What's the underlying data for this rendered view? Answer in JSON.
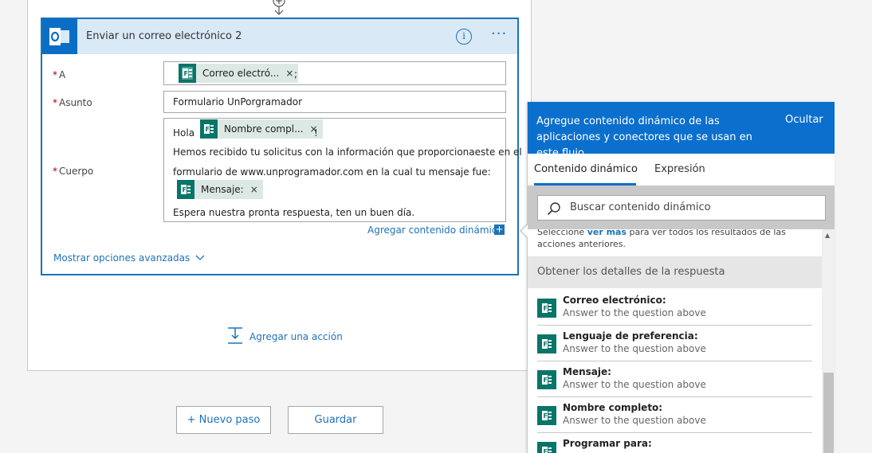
{
  "action": {
    "title": "Enviar un correo electrónico 2",
    "info_glyph": "i",
    "more_glyph": "···",
    "to_label": "A",
    "to_token": "Correo electró...",
    "to_separator": ";",
    "subject_label": "Asunto",
    "subject_value": "Formulario UnPorgramador",
    "body_label": "Cuerpo",
    "body_greeting": "Hola",
    "body_name_token": "Nombre compl...",
    "body_exclaim": "!",
    "body_line1": "Hemos recibido tu solicitus con la información que proporcionaeste en el",
    "body_line2": "formulario de www.unprogramador.com en la cual tu mensaje fue:",
    "body_message_token": "Mensaje:",
    "body_line3": "Espera nuestra pronta respuesta, ten un buen día.",
    "required_mark": "*",
    "token_remove": "×",
    "add_dynamic_label": "Agregar contenido dinámico",
    "add_dynamic_plus": "+",
    "advanced_label": "Mostrar opciones avanzadas"
  },
  "add_action_label": "Agregar una acción",
  "buttons": {
    "new_step": "+ Nuevo paso",
    "save": "Guardar"
  },
  "dynamic_panel": {
    "header_text": "Agregue contenido dinámico de las aplicaciones y conectores que se usan en este flujo.",
    "hide_label": "Ocultar",
    "tab_dynamic": "Contenido dinámico",
    "tab_expression": "Expresión",
    "search_placeholder": "Buscar contenido dinámico",
    "hint_prefix": "Seleccione",
    "hint_link": "ver más",
    "hint_suffix": "para ver todos los resultados de las acciones anteriores.",
    "section_title": "Obtener los detalles de la respuesta",
    "items": [
      {
        "name": "Correo electrónico:",
        "desc": "Answer to the question above"
      },
      {
        "name": "Lenguaje de preferencia:",
        "desc": "Answer to the question above"
      },
      {
        "name": "Mensaje:",
        "desc": "Answer to the question above"
      },
      {
        "name": "Nombre completo:",
        "desc": "Answer to the question above"
      },
      {
        "name": "Programar para:",
        "desc": ""
      }
    ]
  },
  "colors": {
    "accent": "#0b6fcd",
    "forms_green": "#077568",
    "token_bg": "#dce8e4",
    "required": "#a80000"
  },
  "icons": {
    "outlook": "outlook-icon",
    "forms": "forms-icon",
    "search": "search-icon",
    "info": "info-icon",
    "more": "more-options-icon",
    "chevron": "chevron-down-icon"
  }
}
